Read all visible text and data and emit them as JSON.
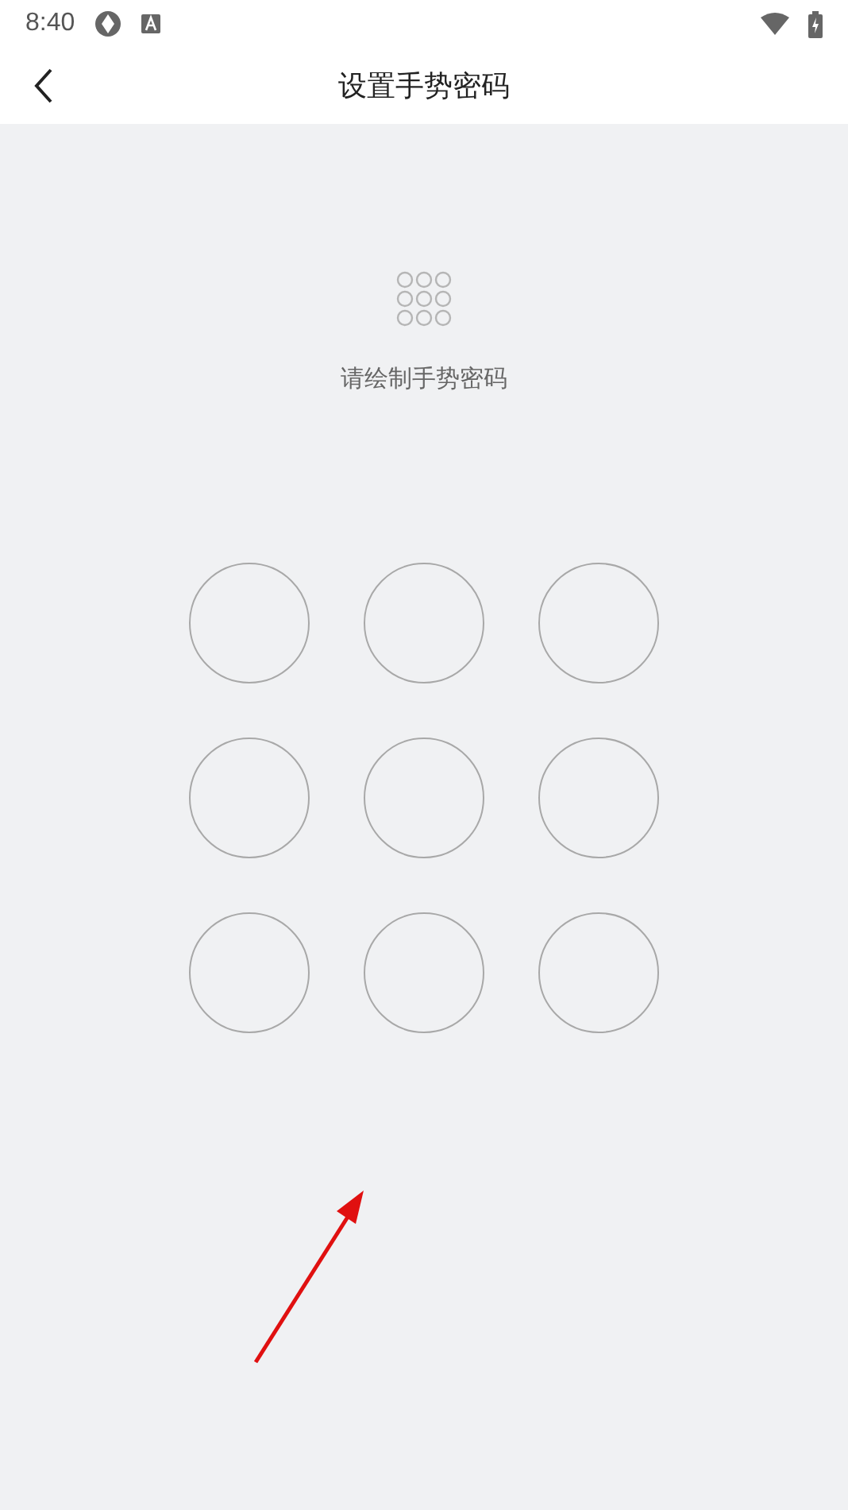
{
  "status_bar": {
    "time": "8:40"
  },
  "header": {
    "title": "设置手势密码"
  },
  "prompt": "请绘制手势密码",
  "nodes": [
    {
      "selected": false
    },
    {
      "selected": false
    },
    {
      "selected": false
    },
    {
      "selected": false
    },
    {
      "selected": false
    },
    {
      "selected": false
    },
    {
      "selected": false
    },
    {
      "selected": false
    },
    {
      "selected": false
    }
  ]
}
